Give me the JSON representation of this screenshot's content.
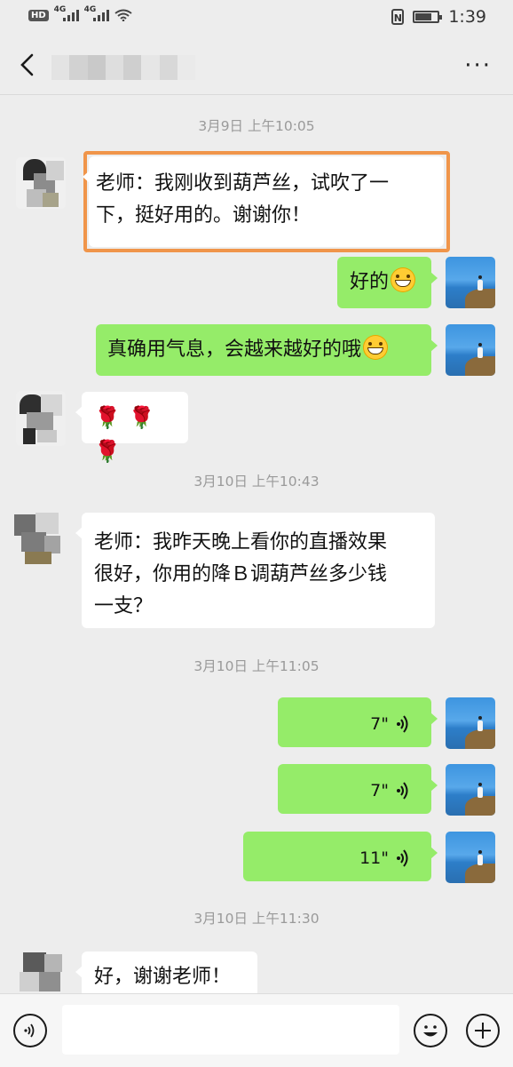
{
  "status_bar": {
    "hd_badge": "HD",
    "signal_1_label": "4G",
    "signal_2_label": "4G",
    "time": "1:39",
    "nfc_label": "N",
    "battery_level": 0.75
  },
  "header": {
    "back_icon": "chevron-left-icon",
    "more_icon": "more-dots-icon",
    "more_label": "···"
  },
  "messages": [
    {
      "type": "timestamp",
      "text": "3月9日 上午10:05"
    },
    {
      "type": "text",
      "side": "left",
      "lines": [
        "老师：我刚收到葫芦丝，试吹了一",
        "下，挺好用的。谢谢你！"
      ],
      "highlighted": true
    },
    {
      "type": "text",
      "side": "right",
      "text": "好的",
      "emoji": "grinning-face"
    },
    {
      "type": "text",
      "side": "right",
      "text": "真确用气息，会越来越好的哦",
      "emoji": "grinning-face"
    },
    {
      "type": "emoji",
      "side": "left",
      "emojis": [
        "🌹",
        "🌹",
        "🌹"
      ]
    },
    {
      "type": "timestamp",
      "text": "3月10日 上午10:43"
    },
    {
      "type": "text",
      "side": "left",
      "lines": [
        "老师：我昨天晚上看你的直播效果",
        "很好，你用的降Ｂ调葫芦丝多少钱",
        "一支？"
      ]
    },
    {
      "type": "timestamp",
      "text": "3月10日 上午11:05"
    },
    {
      "type": "voice",
      "side": "right",
      "duration": "7\""
    },
    {
      "type": "voice",
      "side": "right",
      "duration": "7\""
    },
    {
      "type": "voice",
      "side": "right",
      "duration": "11\""
    },
    {
      "type": "timestamp",
      "text": "3月10日 上午11:30"
    },
    {
      "type": "text",
      "side": "left",
      "text": "好，谢谢老师！"
    }
  ],
  "input_bar": {
    "voice_button_icon": "voice-mode-icon",
    "message_value": "",
    "emoji_button_icon": "emoji-face-icon",
    "more_button_icon": "plus-icon"
  },
  "colors": {
    "chat_background": "#ededed",
    "outgoing_bubble": "#95ec69",
    "incoming_bubble": "#ffffff",
    "highlight_border": "#f0954a"
  }
}
